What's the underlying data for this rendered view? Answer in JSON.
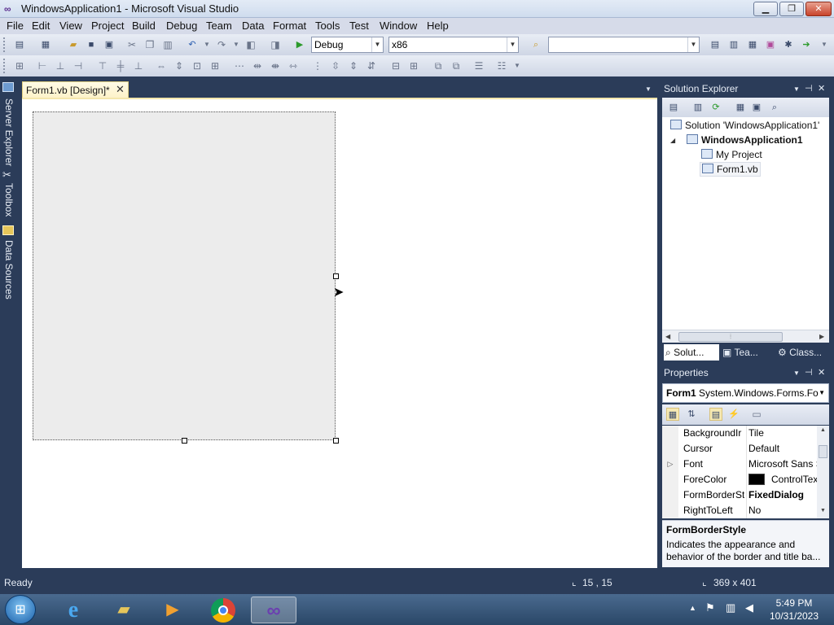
{
  "window": {
    "title": "WindowsApplication1 - Microsoft Visual Studio",
    "icon": "vs-infinity-icon",
    "controls": {
      "minimize": "▁",
      "maximize": "❐",
      "close": "✕"
    }
  },
  "menu": [
    "File",
    "Edit",
    "View",
    "Project",
    "Build",
    "Debug",
    "Team",
    "Data",
    "Format",
    "Tools",
    "Test",
    "Window",
    "Help"
  ],
  "toolbar": {
    "configuration": "Debug",
    "platform": "x86",
    "find_value": ""
  },
  "left_dock": [
    "Server Explorer",
    "Toolbox",
    "Data Sources"
  ],
  "document": {
    "tab_label": "Form1.vb [Design]*",
    "tab_close": "✕"
  },
  "solution_explorer": {
    "title": "Solution Explorer",
    "solution": "Solution 'WindowsApplication1'",
    "project": "WindowsApplication1",
    "items": [
      "My Project",
      "Form1.vb"
    ],
    "tabs": [
      "Solut...",
      "Tea...",
      "Class..."
    ]
  },
  "properties": {
    "title": "Properties",
    "object_name": "Form1",
    "object_type": "System.Windows.Forms.Fo",
    "rows": [
      {
        "name": "BackgroundIr",
        "value": "Tile",
        "bold": false,
        "expand": ""
      },
      {
        "name": "Cursor",
        "value": "Default",
        "bold": false,
        "expand": ""
      },
      {
        "name": "Font",
        "value": "Microsoft Sans S",
        "bold": false,
        "expand": "▷"
      },
      {
        "name": "ForeColor",
        "value": "ControlTex",
        "bold": false,
        "expand": "",
        "swatch": "#000000"
      },
      {
        "name": "FormBorderSt",
        "value": "FixedDialog",
        "bold": true,
        "expand": ""
      },
      {
        "name": "RightToLeft",
        "value": "No",
        "bold": false,
        "expand": ""
      }
    ],
    "desc_title": "FormBorderStyle",
    "desc_text": "Indicates the appearance and behavior of the border and title ba..."
  },
  "status": {
    "text": "Ready",
    "position": "15 , 15",
    "size": "369 x 401"
  },
  "clock": {
    "time": "5:49 PM",
    "date": "10/31/2023"
  },
  "colors": {
    "chrome": "#2b3c59",
    "doc_tab": "#fdf2c8"
  }
}
